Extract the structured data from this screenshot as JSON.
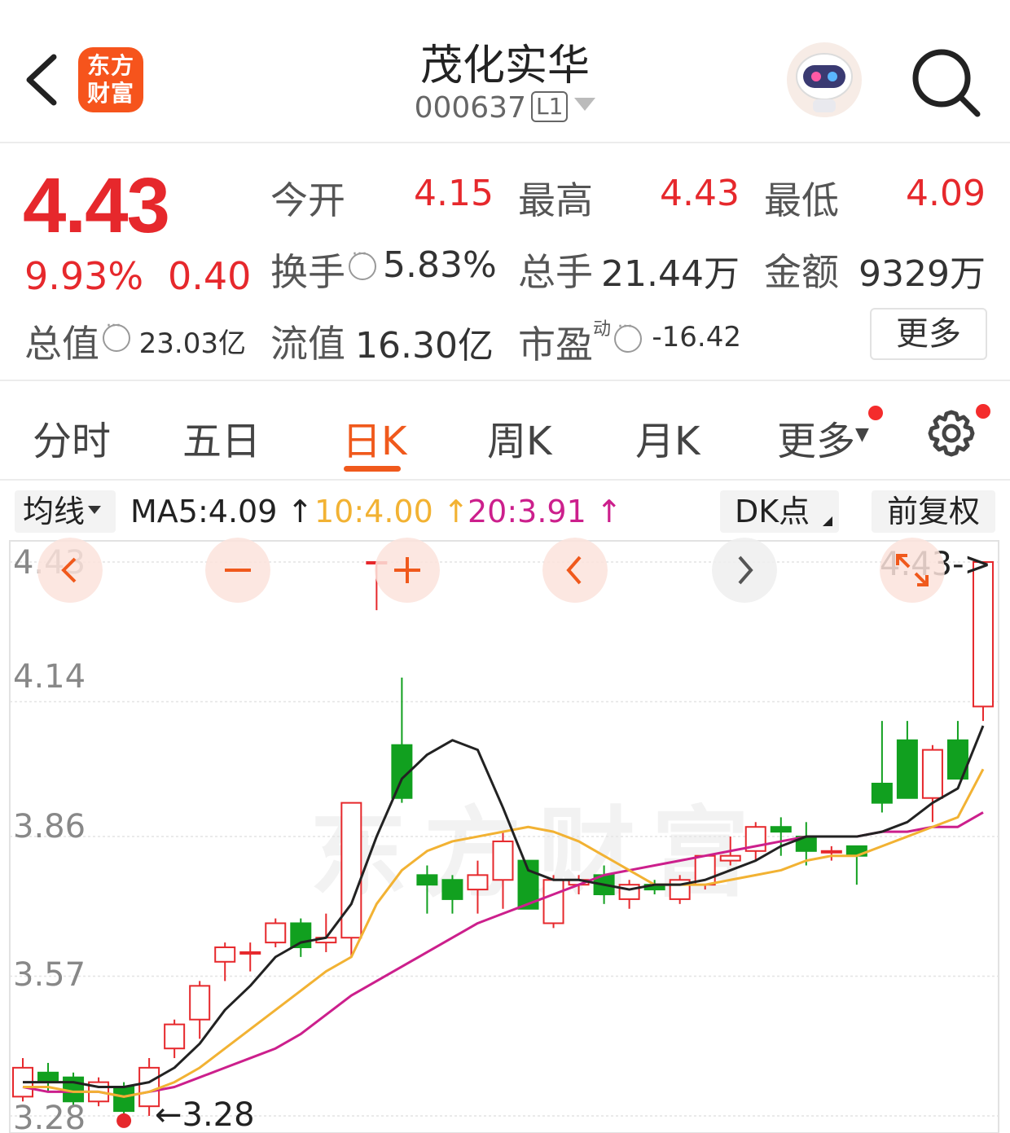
{
  "header": {
    "logo_line1": "东方",
    "logo_line2": "财富",
    "stock_name": "茂化实华",
    "stock_code": "000637",
    "level_badge": "L1"
  },
  "quote": {
    "price": "4.43",
    "change_pct": "9.93%",
    "change_amt": "0.40",
    "open_label": "今开",
    "open": "4.15",
    "high_label": "最高",
    "high": "4.43",
    "low_label": "最低",
    "low": "4.09",
    "turnover_label": "换手",
    "turnover": "5.83%",
    "volume_label": "总手",
    "volume": "21.44万",
    "amount_label": "金额",
    "amount": "9329万",
    "mktcap_label": "总值",
    "mktcap": "23.03亿",
    "float_label": "流值",
    "float": "16.30亿",
    "pe_label": "市盈",
    "pe_sup": "动",
    "pe": "-16.42",
    "more_label": "更多"
  },
  "tabs": [
    "分时",
    "五日",
    "日K",
    "周K",
    "月K",
    "更多"
  ],
  "active_tab": "日K",
  "ma_bar": {
    "select_label": "均线",
    "ma5": "MA5:4.09 ↑",
    "ma10": "10:4.00 ↑",
    "ma20": "20:3.91 ↑",
    "dk_label": "DK点",
    "adjust_label": "前复权"
  },
  "colors": {
    "up": "#e6282c",
    "down": "#11a01f",
    "ma5": "#222222",
    "ma10": "#f2b233",
    "ma20": "#cc1f8c",
    "accent": "#f0591c"
  },
  "chart_data": {
    "type": "candlestick",
    "y_ticks": [
      "4.43",
      "4.14",
      "3.86",
      "3.57",
      "3.28"
    ],
    "ylim": [
      3.28,
      4.43
    ],
    "high_marker": "4.43->",
    "low_marker": "←3.28",
    "watermark": "东方财富",
    "candles": [
      {
        "o": 3.32,
        "c": 3.38,
        "h": 3.4,
        "l": 3.31
      },
      {
        "o": 3.37,
        "c": 3.35,
        "h": 3.39,
        "l": 3.33
      },
      {
        "o": 3.36,
        "c": 3.31,
        "h": 3.37,
        "l": 3.3
      },
      {
        "o": 3.31,
        "c": 3.35,
        "h": 3.36,
        "l": 3.3
      },
      {
        "o": 3.34,
        "c": 3.29,
        "h": 3.35,
        "l": 3.27
      },
      {
        "o": 3.3,
        "c": 3.38,
        "h": 3.4,
        "l": 3.28
      },
      {
        "o": 3.42,
        "c": 3.47,
        "h": 3.48,
        "l": 3.4
      },
      {
        "o": 3.48,
        "c": 3.55,
        "h": 3.56,
        "l": 3.44
      },
      {
        "o": 3.6,
        "c": 3.63,
        "h": 3.64,
        "l": 3.56
      },
      {
        "o": 3.62,
        "c": 3.62,
        "h": 3.64,
        "l": 3.58
      },
      {
        "o": 3.64,
        "c": 3.68,
        "h": 3.69,
        "l": 3.63
      },
      {
        "o": 3.68,
        "c": 3.63,
        "h": 3.69,
        "l": 3.61
      },
      {
        "o": 3.64,
        "c": 3.65,
        "h": 3.7,
        "l": 3.62
      },
      {
        "o": 3.65,
        "c": 3.93,
        "h": 3.93,
        "l": 3.61
      },
      {
        "o": 4.43,
        "c": 4.43,
        "h": 4.43,
        "l": 4.33
      },
      {
        "o": 4.05,
        "c": 3.94,
        "h": 4.19,
        "l": 3.93
      },
      {
        "o": 3.78,
        "c": 3.76,
        "h": 3.8,
        "l": 3.7
      },
      {
        "o": 3.77,
        "c": 3.73,
        "h": 3.78,
        "l": 3.7
      },
      {
        "o": 3.75,
        "c": 3.78,
        "h": 3.81,
        "l": 3.7
      },
      {
        "o": 3.77,
        "c": 3.85,
        "h": 3.87,
        "l": 3.71
      },
      {
        "o": 3.81,
        "c": 3.71,
        "h": 3.81,
        "l": 3.71
      },
      {
        "o": 3.68,
        "c": 3.77,
        "h": 3.78,
        "l": 3.67
      },
      {
        "o": 3.76,
        "c": 3.77,
        "h": 3.78,
        "l": 3.74
      },
      {
        "o": 3.78,
        "c": 3.74,
        "h": 3.8,
        "l": 3.72
      },
      {
        "o": 3.73,
        "c": 3.76,
        "h": 3.77,
        "l": 3.71
      },
      {
        "o": 3.76,
        "c": 3.75,
        "h": 3.77,
        "l": 3.74
      },
      {
        "o": 3.73,
        "c": 3.77,
        "h": 3.78,
        "l": 3.72
      },
      {
        "o": 3.76,
        "c": 3.82,
        "h": 3.82,
        "l": 3.75
      },
      {
        "o": 3.81,
        "c": 3.82,
        "h": 3.86,
        "l": 3.8
      },
      {
        "o": 3.83,
        "c": 3.88,
        "h": 3.89,
        "l": 3.81
      },
      {
        "o": 3.88,
        "c": 3.87,
        "h": 3.9,
        "l": 3.82
      },
      {
        "o": 3.86,
        "c": 3.83,
        "h": 3.89,
        "l": 3.8
      },
      {
        "o": 3.83,
        "c": 3.83,
        "h": 3.84,
        "l": 3.81
      },
      {
        "o": 3.84,
        "c": 3.82,
        "h": 3.84,
        "l": 3.76
      },
      {
        "o": 3.97,
        "c": 3.93,
        "h": 4.1,
        "l": 3.91
      },
      {
        "o": 4.06,
        "c": 3.94,
        "h": 4.1,
        "l": 3.94
      },
      {
        "o": 3.94,
        "c": 4.04,
        "h": 4.05,
        "l": 3.89
      },
      {
        "o": 4.06,
        "c": 3.98,
        "h": 4.1,
        "l": 3.98
      },
      {
        "o": 4.13,
        "c": 4.43,
        "h": 4.43,
        "l": 4.1
      }
    ],
    "ma5": [
      3.35,
      3.35,
      3.35,
      3.34,
      3.34,
      3.35,
      3.38,
      3.43,
      3.5,
      3.55,
      3.61,
      3.64,
      3.65,
      3.72,
      3.86,
      3.98,
      4.03,
      4.06,
      4.04,
      3.92,
      3.79,
      3.77,
      3.77,
      3.76,
      3.75,
      3.76,
      3.76,
      3.77,
      3.79,
      3.81,
      3.84,
      3.86,
      3.86,
      3.86,
      3.87,
      3.89,
      3.93,
      3.96,
      4.09
    ],
    "ma10": [
      3.34,
      3.34,
      3.33,
      3.33,
      3.32,
      3.33,
      3.35,
      3.38,
      3.42,
      3.46,
      3.5,
      3.54,
      3.58,
      3.61,
      3.72,
      3.79,
      3.83,
      3.85,
      3.86,
      3.87,
      3.88,
      3.87,
      3.85,
      3.82,
      3.79,
      3.76,
      3.76,
      3.76,
      3.77,
      3.78,
      3.79,
      3.81,
      3.82,
      3.82,
      3.84,
      3.86,
      3.88,
      3.9,
      4.0
    ],
    "ma20": [
      3.34,
      3.33,
      3.33,
      3.33,
      3.32,
      3.33,
      3.34,
      3.36,
      3.38,
      3.4,
      3.42,
      3.45,
      3.49,
      3.53,
      3.56,
      3.59,
      3.62,
      3.65,
      3.68,
      3.7,
      3.72,
      3.74,
      3.76,
      3.78,
      3.79,
      3.8,
      3.81,
      3.82,
      3.83,
      3.84,
      3.85,
      3.86,
      3.86,
      3.86,
      3.87,
      3.87,
      3.88,
      3.88,
      3.91
    ]
  }
}
